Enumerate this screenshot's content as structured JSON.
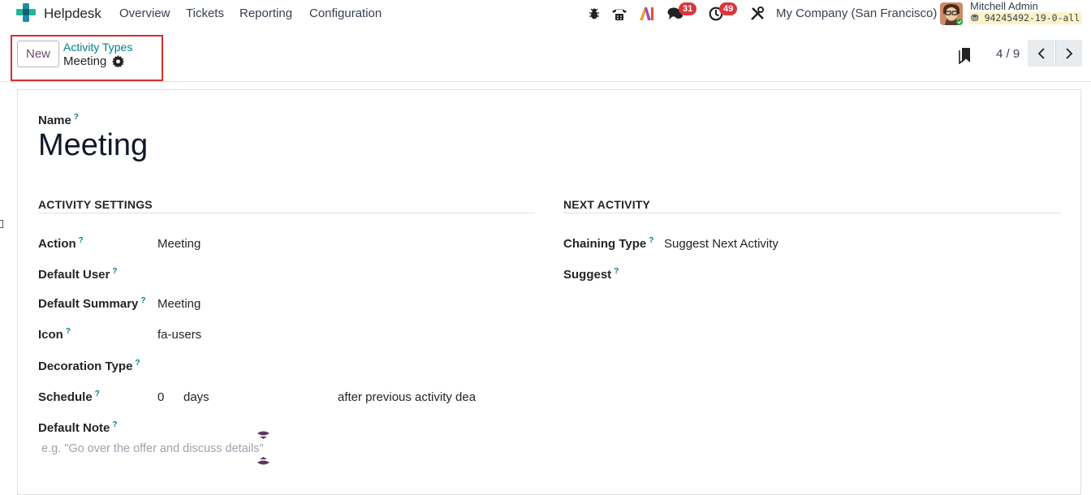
{
  "topnav": {
    "app_name": "Helpdesk",
    "menu": [
      "Overview",
      "Tickets",
      "Reporting",
      "Configuration"
    ],
    "icons": [
      "bug-icon",
      "phone-icon",
      "ai-icon",
      "chat-icon",
      "clock-icon",
      "tools-icon"
    ],
    "messages_badge": "31",
    "activities_badge": "49",
    "company": "My Company (San Francisco)",
    "user_name": "Mitchell Admin",
    "db_name": "94245492-19-0-all"
  },
  "control_panel": {
    "new_button": "New",
    "breadcrumb_parent": "Activity Types",
    "breadcrumb_current": "Meeting",
    "pager": "4 / 9"
  },
  "form": {
    "name_label": "Name",
    "name_value": "Meeting",
    "help_mark": "?",
    "activity_settings": {
      "title": "ACTIVITY SETTINGS",
      "action_label": "Action",
      "action_value": "Meeting",
      "default_user_label": "Default User",
      "default_summary_label": "Default Summary",
      "default_summary_value": "Meeting",
      "icon_label": "Icon",
      "icon_value": "fa-users",
      "decoration_type_label": "Decoration Type",
      "schedule_label": "Schedule",
      "schedule_value": "0",
      "schedule_unit": "days",
      "schedule_from": "after previous activity deac",
      "default_note_label": "Default Note",
      "default_note_placeholder": "e.g. \"Go over the offer and discuss details\""
    },
    "next_activity": {
      "title": "NEXT ACTIVITY",
      "chaining_type_label": "Chaining Type",
      "chaining_type_value": "Suggest Next Activity",
      "suggest_label": "Suggest"
    }
  },
  "colors": {
    "brand": "#714b67",
    "link": "#017e84",
    "badge": "#d9363e",
    "highlight": "#d32f2f"
  }
}
